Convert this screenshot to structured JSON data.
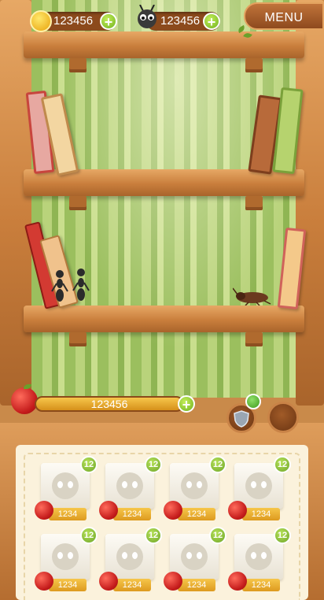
{
  "hud": {
    "coins": "123456",
    "ants": "123456",
    "menu_label": "MENU"
  },
  "progress": {
    "value_label": "123456"
  },
  "shop": {
    "items": [
      {
        "level": "12",
        "price": "1234"
      },
      {
        "level": "12",
        "price": "1234"
      },
      {
        "level": "12",
        "price": "1234"
      },
      {
        "level": "12",
        "price": "1234"
      },
      {
        "level": "12",
        "price": "1234"
      },
      {
        "level": "12",
        "price": "1234"
      },
      {
        "level": "12",
        "price": "1234"
      },
      {
        "level": "12",
        "price": "1234"
      }
    ]
  },
  "colors": {
    "wood": "#c97e3c",
    "wall_stripe": "#9bbf5e",
    "accent_green": "#6fb21f",
    "gold": "#f6c64a",
    "apple_red": "#c41b1b"
  },
  "icons": [
    "coin-icon",
    "ant-icon",
    "plus-icon",
    "apple-icon",
    "shield-icon",
    "leaf-icon"
  ]
}
